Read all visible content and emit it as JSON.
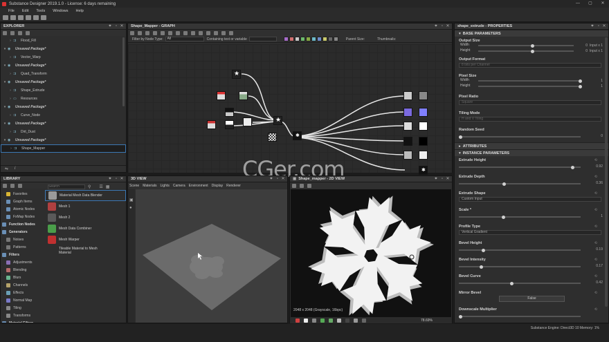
{
  "window": {
    "title": "Substance Designer 2019.1.0 - License: 6 days remaining",
    "min": "—",
    "max": "▢",
    "close": "✕"
  },
  "menu": [
    "File",
    "Edit",
    "Tools",
    "Windows",
    "Help"
  ],
  "explorer": {
    "title": "EXPLORER",
    "items": [
      {
        "label": "Flood_Fill",
        "type": "graph"
      },
      {
        "label": "Unsaved Package*",
        "type": "pkg"
      },
      {
        "label": "Vector_Warp",
        "type": "graph"
      },
      {
        "label": "Unsaved Package*",
        "type": "pkg"
      },
      {
        "label": "Quad_Transform",
        "type": "graph"
      },
      {
        "label": "Unsaved Package*",
        "type": "pkg"
      },
      {
        "label": "Shape_Extrude",
        "type": "graph"
      },
      {
        "label": "Resources",
        "type": "folder"
      },
      {
        "label": "Unsaved Package*",
        "type": "pkg"
      },
      {
        "label": "Curve_Node",
        "type": "graph"
      },
      {
        "label": "Unsaved Package*",
        "type": "pkg"
      },
      {
        "label": "Dirt_Dust",
        "type": "graph"
      },
      {
        "label": "Unsaved Package*",
        "type": "pkg"
      },
      {
        "label": "Shape_Mapper",
        "type": "graph"
      }
    ]
  },
  "library": {
    "title": "LIBRARY",
    "search_placeholder": "Search",
    "categories": [
      {
        "label": "Favorites",
        "hdr": false,
        "color": "#d9b533"
      },
      {
        "label": "Graph Items",
        "hdr": false,
        "color": "#6a8fb5"
      },
      {
        "label": "Atomic Nodes",
        "hdr": false,
        "color": "#6a8fb5"
      },
      {
        "label": "FxMap Nodes",
        "hdr": false,
        "color": "#6a8fb5"
      },
      {
        "label": "Function Nodes",
        "hdr": true,
        "color": "#6a8fb5"
      },
      {
        "label": "Generators",
        "hdr": true,
        "color": "#6a8fb5"
      },
      {
        "label": "Noises",
        "hdr": false,
        "color": "#777777"
      },
      {
        "label": "Patterns",
        "hdr": false,
        "color": "#777777"
      },
      {
        "label": "Filters",
        "hdr": true,
        "color": "#6a8fb5"
      },
      {
        "label": "Adjustments",
        "hdr": false,
        "color": "#8a6fb5"
      },
      {
        "label": "Blending",
        "hdr": false,
        "color": "#b56a6a"
      },
      {
        "label": "Blurs",
        "hdr": false,
        "color": "#6ab58f"
      },
      {
        "label": "Channels",
        "hdr": false,
        "color": "#b5a26a"
      },
      {
        "label": "Effects",
        "hdr": false,
        "color": "#6a9fb5"
      },
      {
        "label": "Normal Map",
        "hdr": false,
        "color": "#7a7ac8"
      },
      {
        "label": "Tiling",
        "hdr": false,
        "color": "#888888"
      },
      {
        "label": "Transforms",
        "hdr": false,
        "color": "#888888"
      },
      {
        "label": "Material Filters",
        "hdr": true,
        "color": "#6a8fb5"
      }
    ],
    "items": [
      {
        "label": "Material Mesh Data Blender",
        "thumb": "#9a9a9a"
      },
      {
        "label": "Mesh 1",
        "thumb": "#b04040"
      },
      {
        "label": "Mesh 2",
        "thumb": "#5a5a5a"
      },
      {
        "label": "Mesh Data Combiner",
        "thumb": "#4a9e4a"
      },
      {
        "label": "Mesh Warper",
        "thumb": "#c03030"
      },
      {
        "label": "Tileable Material to Mesh Material",
        "thumb": "#2e2e2e"
      }
    ]
  },
  "graph": {
    "title": "Shape_Mapper - GRAPH",
    "filter_label": "Filter by Node Type:",
    "filter_value": "All",
    "containing_label": "Containing text or variable",
    "parent_size": "Parent Size:",
    "thumbnails": "Thumbnails:"
  },
  "view3d": {
    "title": "3D VIEW",
    "menu": [
      "Scene",
      "Materials",
      "Lights",
      "Camera",
      "Environment",
      "Display",
      "Renderer"
    ]
  },
  "view2d": {
    "title": "Shape_mapper - 2D VIEW",
    "status": "2048 x 2048 (Grayscale, 16bpc)",
    "zoom": "78.69%"
  },
  "props": {
    "title": "shape_extrude - PROPERTIES",
    "base_header": "BASE PARAMETERS",
    "output_size": "Output Size",
    "width": "Width",
    "height": "Height",
    "w_val": "0",
    "h_val": "0",
    "w_rel": "Input x 1",
    "h_rel": "Input x 1",
    "output_format": "Output Format",
    "output_format_val": "8 bits per Channel",
    "pixel_size": "Pixel Size",
    "ps_w": "1",
    "ps_h": "1",
    "pixel_ratio": "Pixel Ratio",
    "pixel_ratio_val": "Square",
    "tiling_mode": "Tiling Mode",
    "tiling_mode_val": "H and V Tiling",
    "random_seed": "Random Seed",
    "random_seed_val": "0",
    "attributes": "ATTRIBUTES",
    "instance": "INSTANCE PARAMETERS",
    "params": [
      {
        "label": "Extrude Height",
        "value": "0.92",
        "pos": 0.92
      },
      {
        "label": "Extrude Depth",
        "value": "0.36",
        "pos": 0.36
      },
      {
        "label": "Extrude Shape",
        "value": "Custom Input",
        "dd": true
      },
      {
        "label": "Scale *",
        "value": "1",
        "pos": 0.35
      },
      {
        "label": "Profile Type",
        "value": "Vertical Gradient",
        "dd": true
      },
      {
        "label": "Bevel Height",
        "value": "0.19",
        "pos": 0.19
      },
      {
        "label": "Bevel Intensity",
        "value": "0.17",
        "pos": 0.17
      },
      {
        "label": "Bevel Curve",
        "value": "0.42",
        "pos": 0.42
      },
      {
        "label": "Mirror Bevel",
        "value": "False",
        "btn": true
      },
      {
        "label": "Downscale Multiplier",
        "value": "",
        "pos": 0.0
      }
    ],
    "engine": "Substance Engine: Direct3D 10  Memory: 1%"
  },
  "watermark": "CGer.com"
}
